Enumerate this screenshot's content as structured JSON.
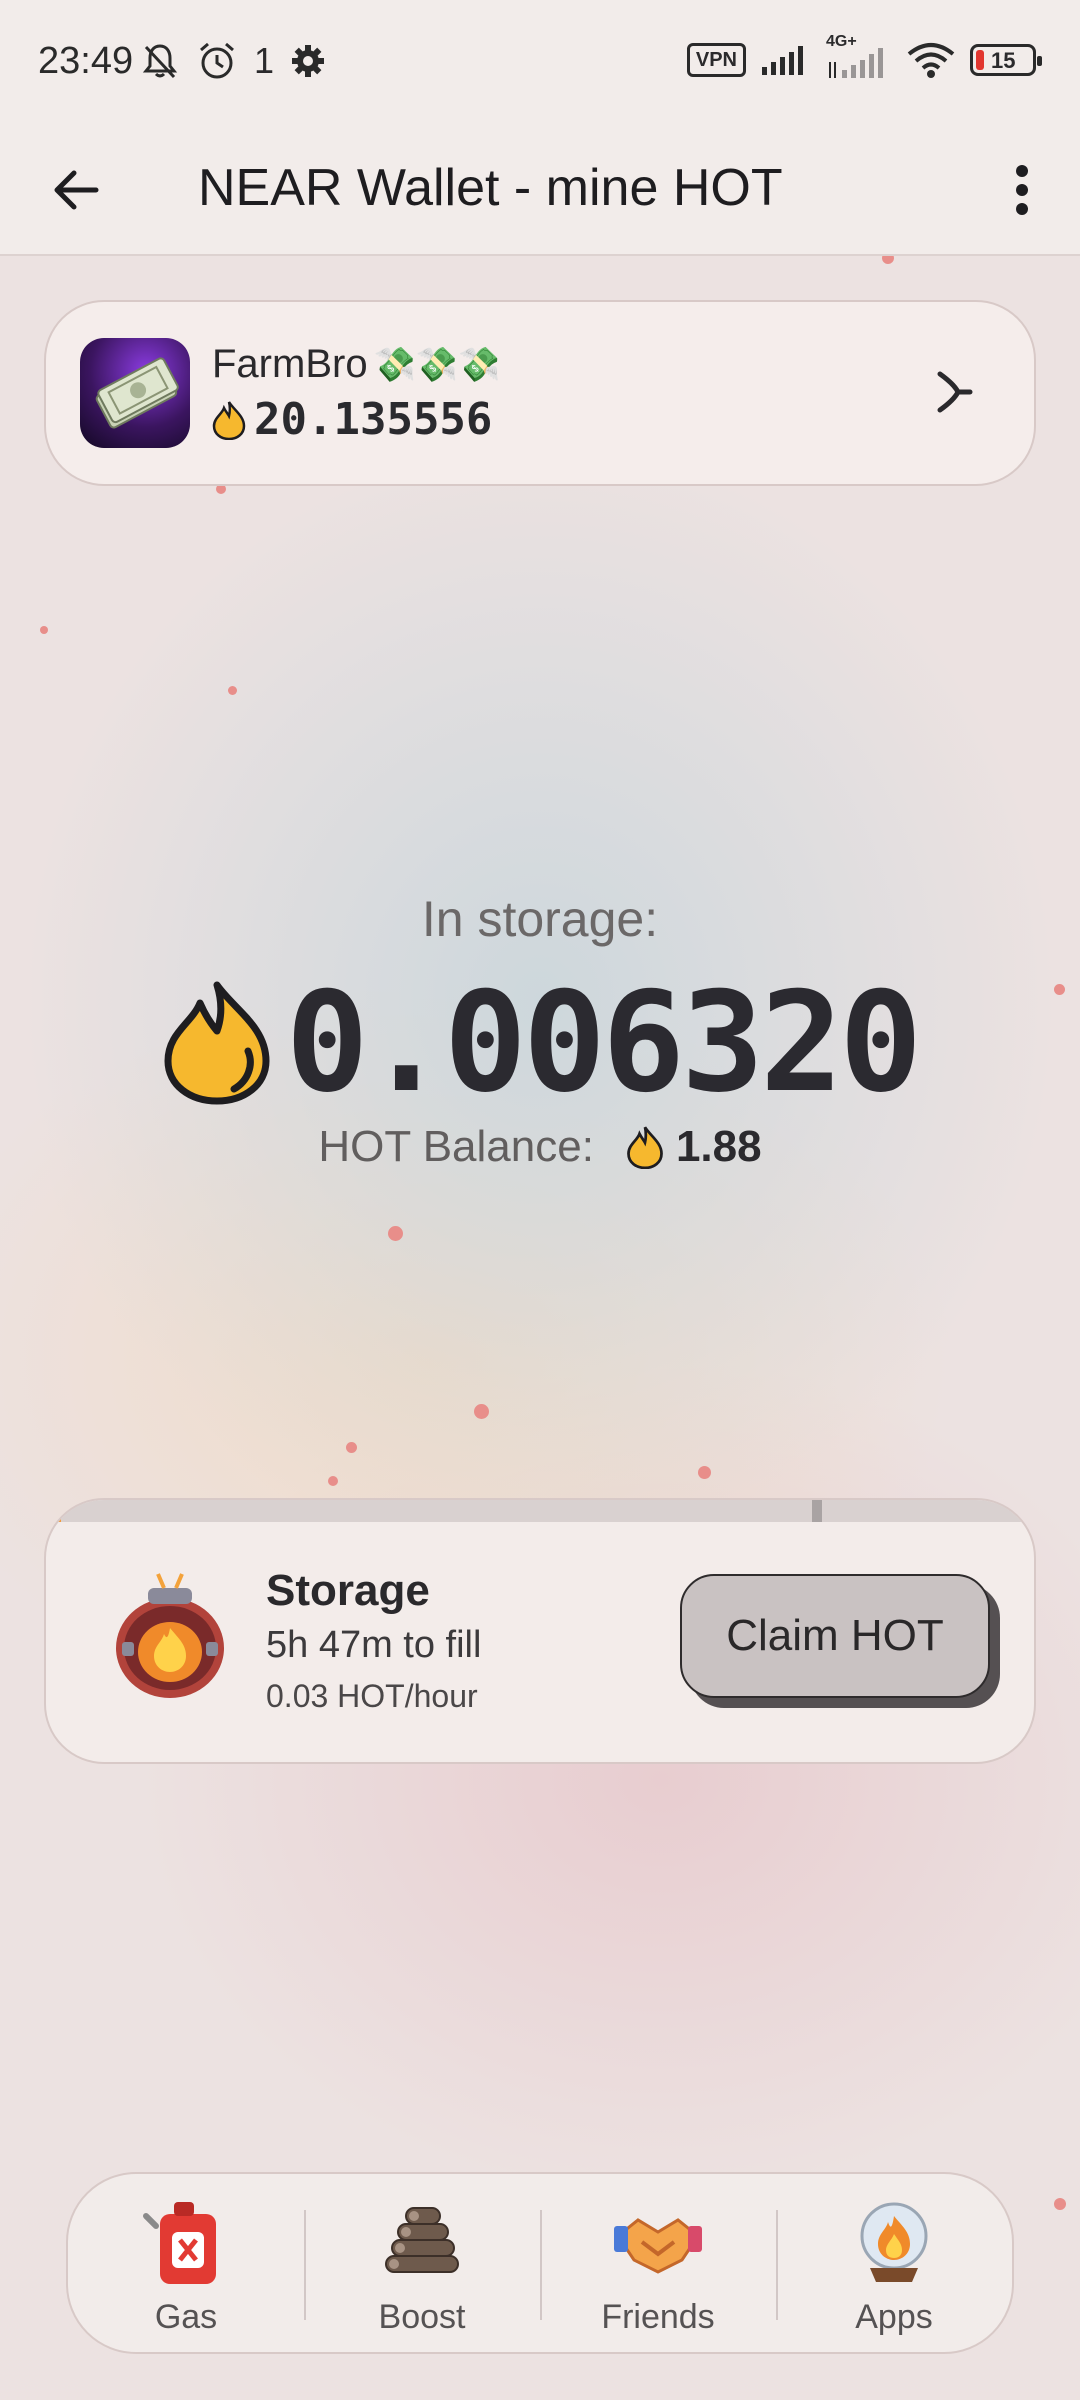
{
  "status_bar": {
    "time": "23:49",
    "notification_count": "1",
    "vpn_label": "VPN",
    "network_label": "4G+",
    "battery_level": "15",
    "icons": [
      "mute-bell-icon",
      "alarm-icon",
      "settings-gear-icon",
      "signal-icon",
      "wifi-icon",
      "battery-icon"
    ]
  },
  "app_bar": {
    "title": "NEAR Wallet - mine HOT",
    "back_icon": "arrow-left-icon",
    "more_icon": "more-vert-icon"
  },
  "profile": {
    "name": "FarmBro",
    "name_emojis": "💸💸💸",
    "balance": "20.135556",
    "avatar_icon": "money-stack-icon"
  },
  "storage": {
    "label": "In storage:",
    "value": "0.006320",
    "balance_label": "HOT Balance:",
    "balance_value": "1.88"
  },
  "storage_card": {
    "title": "Storage",
    "time_to_fill": "5h 47m to fill",
    "rate": "0.03 HOT/hour",
    "claim_label": "Claim HOT",
    "progress_fraction": 0.015
  },
  "nav": {
    "items": [
      {
        "label": "Gas",
        "icon": "gas-can-icon"
      },
      {
        "label": "Boost",
        "icon": "logs-boost-icon"
      },
      {
        "label": "Friends",
        "icon": "handshake-icon"
      },
      {
        "label": "Apps",
        "icon": "crystal-ball-icon"
      }
    ]
  },
  "colors": {
    "flame": "#f6b82e",
    "accent_progress": "#f39a3b",
    "text_dark": "#2b2a30",
    "card_bg": "#f3ecea"
  }
}
